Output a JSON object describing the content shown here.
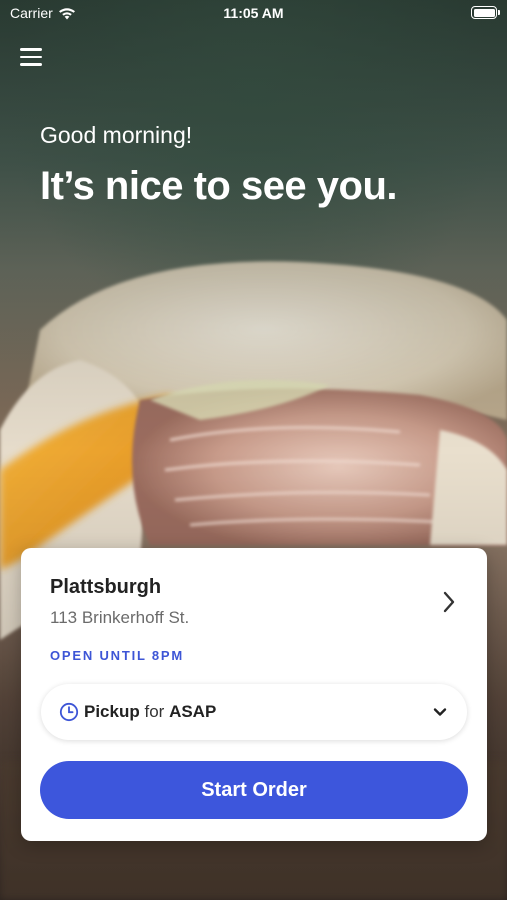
{
  "status_bar": {
    "carrier": "Carrier",
    "time": "11:05 AM"
  },
  "hero": {
    "greeting": "Good morning!",
    "headline": "It’s nice to see you."
  },
  "location_card": {
    "name": "Plattsburgh",
    "address": "113 Brinkerhoff St.",
    "hours": "OPEN UNTIL 8PM",
    "pickup_mode": "Pickup",
    "pickup_for": "for",
    "pickup_time": "ASAP",
    "start_order_label": "Start Order"
  },
  "colors": {
    "accent": "#3d56dc",
    "hours_text": "#3d55d6",
    "card_bg": "#ffffff"
  },
  "icons": {
    "menu": "hamburger-menu-icon",
    "wifi": "wifi-icon",
    "battery": "battery-icon",
    "chevron_right": "chevron-right-icon",
    "clock": "clock-icon",
    "chevron_down": "chevron-down-icon"
  }
}
